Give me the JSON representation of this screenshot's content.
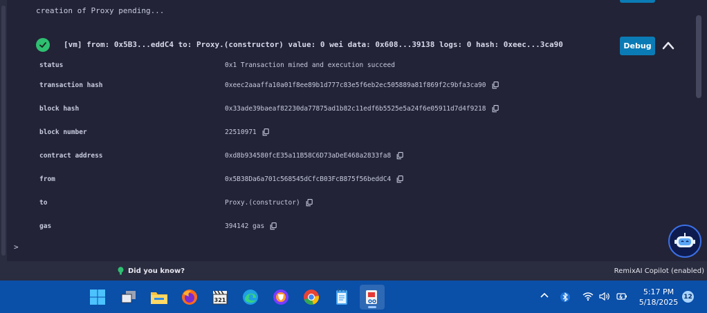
{
  "terminal": {
    "pending_message": "creation of Proxy pending...",
    "tx_summary": "[vm]  from: 0x5B3...eddC4 to: Proxy.(constructor) value: 0 wei data: 0x608...39138 logs: 0 hash: 0xeec...3ca90",
    "debug_label": "Debug",
    "rows": [
      {
        "key": "status",
        "value": "0x1 Transaction mined and execution succeed",
        "copy": false
      },
      {
        "key": "transaction hash",
        "value": "0xeec2aaaffa10a01f8ee89b1d777c83e5f6eb2ec505889a81f869f2c9bfa3ca90",
        "copy": true
      },
      {
        "key": "block hash",
        "value": "0x33ade39baeaf82230da77875ad1b82c11edf6b5525e5a24f6e05911d7d4f9218",
        "copy": true
      },
      {
        "key": "block number",
        "value": "22510971",
        "copy": true
      },
      {
        "key": "contract address",
        "value": "0xd8b934580fcE35a11B58C6D73aDeE468a2833fa8",
        "copy": true
      },
      {
        "key": "from",
        "value": "0x5B38Da6a701c568545dCfcB03FcB875f56beddC4",
        "copy": true
      },
      {
        "key": "to",
        "value": "Proxy.(constructor)",
        "copy": true
      },
      {
        "key": "gas",
        "value": "394142 gas",
        "copy": true
      }
    ],
    "prompt": ">"
  },
  "statusbar": {
    "tip": "Did you know?",
    "copilot_status": "RemixAI Copilot (enabled)"
  },
  "taskbar": {
    "time": "5:17 PM",
    "date": "5/18/2025",
    "notification_count": "12",
    "apps": [
      "windows-start-icon",
      "task-view-icon",
      "file-explorer-icon",
      "firefox-icon",
      "clapperboard-icon",
      "edge-icon",
      "brave-icon",
      "chrome-icon",
      "notepad-icon",
      "snipping-tool-icon"
    ]
  },
  "colors": {
    "background": "#222336",
    "accent": "#0b7bb5",
    "success": "#2fbf71",
    "taskbar": "#0a4fa8"
  }
}
